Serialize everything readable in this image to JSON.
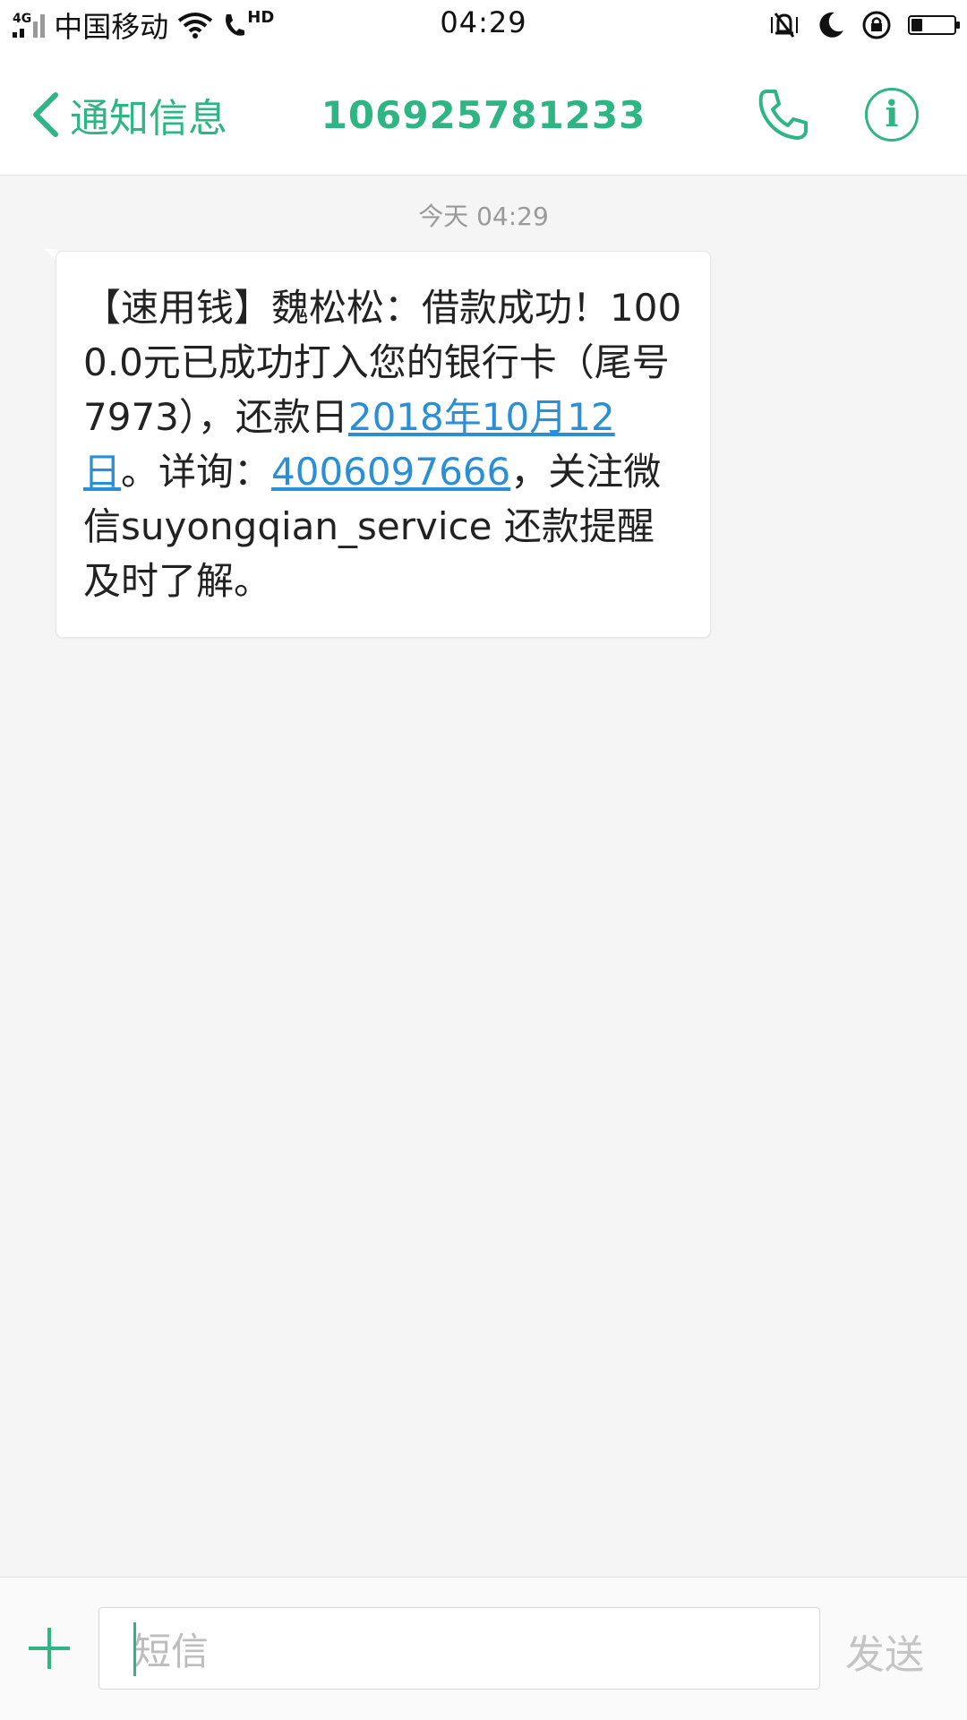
{
  "status_bar": {
    "network_type": "4G",
    "carrier": "中国移动",
    "volte": "HD",
    "time": "04:29",
    "icons": [
      "signal-icon",
      "wifi-icon",
      "hd-call-icon",
      "vibrate-icon",
      "do-not-disturb-icon",
      "rotation-lock-icon",
      "battery-icon"
    ],
    "battery_level": 0.25
  },
  "header": {
    "back_label": "通知信息",
    "title": "106925781233",
    "call_icon": "phone-icon",
    "info_label": "i",
    "accent_color": "#2fb584"
  },
  "thread": {
    "timestamp": "今天 04:29",
    "message": {
      "part1": "【速用钱】魏松松：借款成功！1000.0元已成功打入您的银行卡（尾号7973），还款日",
      "date_link": "2018年10月12日",
      "part2": "。详询：",
      "phone_link": "4006097666",
      "part3": "，关注微信suyongqian_service 还款提醒及时了解。"
    },
    "link_color": "#2a8fd6"
  },
  "compose": {
    "add_icon": "plus-icon",
    "placeholder": "短信",
    "send_label": "发送"
  }
}
